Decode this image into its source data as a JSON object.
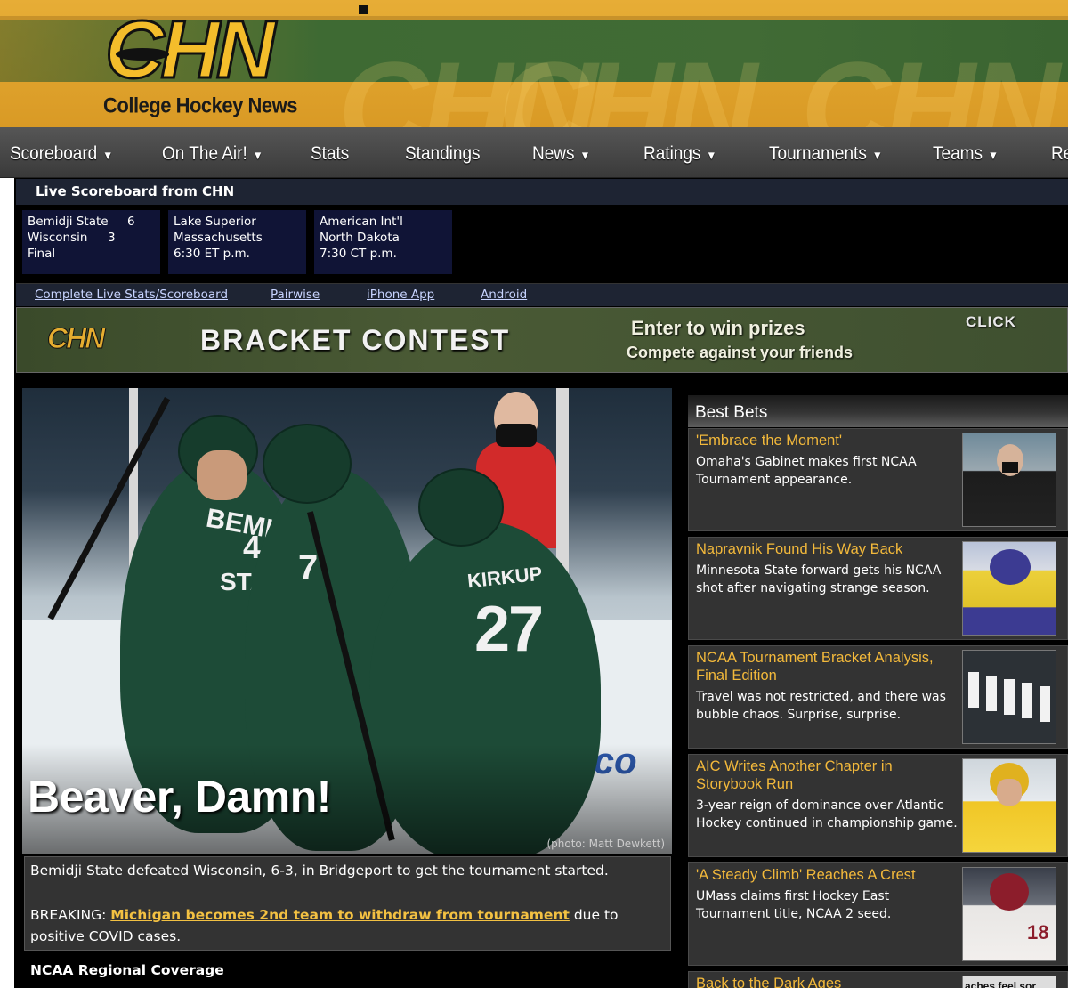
{
  "header": {
    "logo_text": "CHN",
    "logo_subtitle": "College Hockey News"
  },
  "nav": {
    "items": [
      {
        "label": "Scoreboard",
        "dropdown": true
      },
      {
        "label": "On The Air!",
        "dropdown": true
      },
      {
        "label": "Stats",
        "dropdown": false
      },
      {
        "label": "Standings",
        "dropdown": false
      },
      {
        "label": "News",
        "dropdown": true
      },
      {
        "label": "Ratings",
        "dropdown": true
      },
      {
        "label": "Tournaments",
        "dropdown": true
      },
      {
        "label": "Teams",
        "dropdown": true
      },
      {
        "label": "Re",
        "dropdown": false
      }
    ],
    "caret": "▼"
  },
  "scoreboard": {
    "title": "Live Scoreboard from CHN",
    "games": [
      {
        "team1": "Bemidji State",
        "score1": "6",
        "team2": "Wisconsin",
        "score2": "3",
        "status": "Final"
      },
      {
        "team1": "Lake Superior",
        "score1": "",
        "team2": "Massachusetts",
        "score2": "",
        "status": "6:30 ET p.m."
      },
      {
        "team1": "American Int'l",
        "score1": "",
        "team2": "North Dakota",
        "score2": "",
        "status": "7:30 CT p.m."
      }
    ],
    "links": [
      "Complete Live Stats/Scoreboard",
      "Pairwise",
      "iPhone App",
      "Android"
    ]
  },
  "ad": {
    "logo": "CHN",
    "title": "BRACKET CONTEST",
    "line1": "Enter to win prizes",
    "line2": "Compete against your friends",
    "cta": "CLICK"
  },
  "hero": {
    "headline": "Beaver, Damn!",
    "credit": "(photo: Matt Dewkett)",
    "jersey_names": [
      "KIRKUP",
      "BEMIDJI",
      "STA"
    ],
    "jersey_numbers": [
      "27",
      "4",
      "7"
    ],
    "caption": "Bemidji State defeated Wisconsin, 6-3, in Bridgeport to get the tournament started.",
    "breaking_prefix": "BREAKING: ",
    "breaking_link": "Michigan becomes 2nd team to withdraw from tournament",
    "breaking_suffix": " due to positive COVID cases.",
    "regional_link": "NCAA Regional Coverage"
  },
  "best_bets": {
    "title": "Best Bets",
    "items": [
      {
        "title": "'Embrace the Moment'",
        "desc": "Omaha's Gabinet makes first NCAA Tournament appearance.",
        "thumb_icon": "coach-photo"
      },
      {
        "title": "Napravnik Found His Way Back",
        "desc": "Minnesota State forward gets his NCAA shot after navigating strange season.",
        "thumb_icon": "player-photo"
      },
      {
        "title": "NCAA Tournament Bracket Analysis, Final Edition",
        "desc": "Travel was not restricted, and there was bubble chaos. Surprise, surprise.",
        "thumb_icon": "banners-photo"
      },
      {
        "title": "AIC Writes Another Chapter in Storybook Run",
        "desc": "3-year reign of dominance over Atlantic Hockey continued in championship game.",
        "thumb_icon": "player-photo"
      },
      {
        "title": "'A Steady Climb' Reaches A Crest",
        "desc": "UMass claims first Hockey East Tournament title, NCAA 2 seed.",
        "thumb_icon": "player-photo"
      },
      {
        "title": "Back to the Dark Ages",
        "desc": "",
        "thumb_text": "aches feel sor",
        "thumb_icon": "text-photo"
      }
    ]
  },
  "colors": {
    "banner_gold": "#e7ad36",
    "banner_green": "#3e6a33",
    "link_gold": "#f3b93b",
    "scoreboard_bg": "#101436",
    "nav_bg": "#4a4a4a"
  }
}
